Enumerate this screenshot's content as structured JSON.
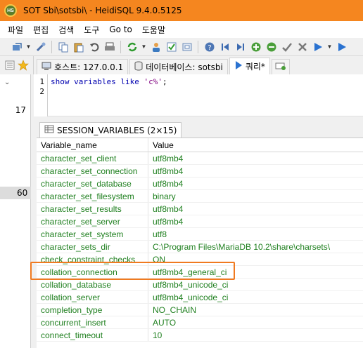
{
  "window": {
    "title": "SOT Sbi\\sotsbi\\ - HeidiSQL 9.4.0.5125",
    "icon_text": "HS"
  },
  "menu": [
    "파일",
    "편집",
    "검색",
    "도구",
    "Go to",
    "도움말"
  ],
  "tabs": {
    "host": "호스트: 127.0.0.1",
    "database": "데이터베이스: sotsbi",
    "query": "쿼리*"
  },
  "left_panel": {
    "numbers": [
      "17",
      "60"
    ]
  },
  "editor": {
    "line_numbers": [
      "1",
      "2"
    ],
    "query_keyword": "show variables like",
    "query_string": "'c%'",
    "query_end": ";"
  },
  "result": {
    "tab_label": "SESSION_VARIABLES (2×15)",
    "columns": [
      "Variable_name",
      "Value"
    ],
    "rows": [
      [
        "character_set_client",
        "utf8mb4"
      ],
      [
        "character_set_connection",
        "utf8mb4"
      ],
      [
        "character_set_database",
        "utf8mb4"
      ],
      [
        "character_set_filesystem",
        "binary"
      ],
      [
        "character_set_results",
        "utf8mb4"
      ],
      [
        "character_set_server",
        "utf8mb4"
      ],
      [
        "character_set_system",
        "utf8"
      ],
      [
        "character_sets_dir",
        "C:\\Program Files\\MariaDB 10.2\\share\\charsets\\"
      ],
      [
        "check_constraint_checks",
        "ON"
      ],
      [
        "collation_connection",
        "utf8mb4_general_ci"
      ],
      [
        "collation_database",
        "utf8mb4_unicode_ci"
      ],
      [
        "collation_server",
        "utf8mb4_unicode_ci"
      ],
      [
        "completion_type",
        "NO_CHAIN"
      ],
      [
        "concurrent_insert",
        "AUTO"
      ],
      [
        "connect_timeout",
        "10"
      ]
    ]
  },
  "colors": {
    "titlebar": "#f5861f",
    "value_text": "#208020",
    "highlight": "#f07a20"
  }
}
